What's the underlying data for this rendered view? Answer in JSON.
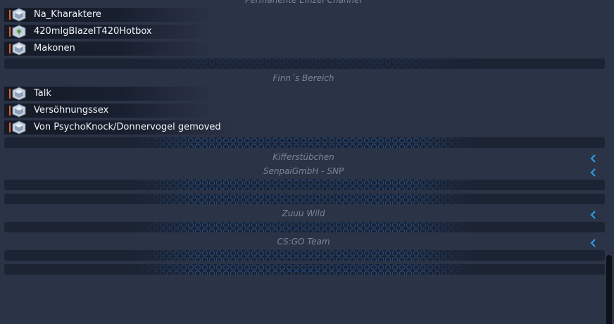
{
  "groups": [
    {
      "header": "Permanente Einzel Channel",
      "channels": [
        {
          "name": "Na_Kharaktere",
          "icon": "channel-icon"
        },
        {
          "name": "420mlgBlazeIT420Hotbox",
          "icon": "weed-channel-icon"
        },
        {
          "name": "Makonen",
          "icon": "channel-icon"
        }
      ]
    },
    {
      "header": "Finn´s Bereich",
      "channels": [
        {
          "name": "Talk",
          "icon": "channel-icon"
        },
        {
          "name": "Versöhnungssex",
          "icon": "channel-icon"
        },
        {
          "name": "Von PsychoKnock/Donnervogel gemoved",
          "icon": "channel-icon"
        }
      ]
    },
    {
      "header": "Kifferstübchen",
      "collapsed": true
    },
    {
      "header": "SenpaiGmbH - SNP",
      "collapsed": true
    },
    {
      "header": "Zuuu Wild",
      "collapsed": true
    },
    {
      "header": "CS:GO Team",
      "collapsed": true
    }
  ],
  "colors": {
    "background": "#2b3346",
    "spacer": "#1c2333",
    "hex_pattern": "#2a6eb8",
    "chevron": "#2f9ee8",
    "channel_marker": "#d9632c",
    "channel_text": "#f2f4f8",
    "header_text": "#7c8599"
  }
}
